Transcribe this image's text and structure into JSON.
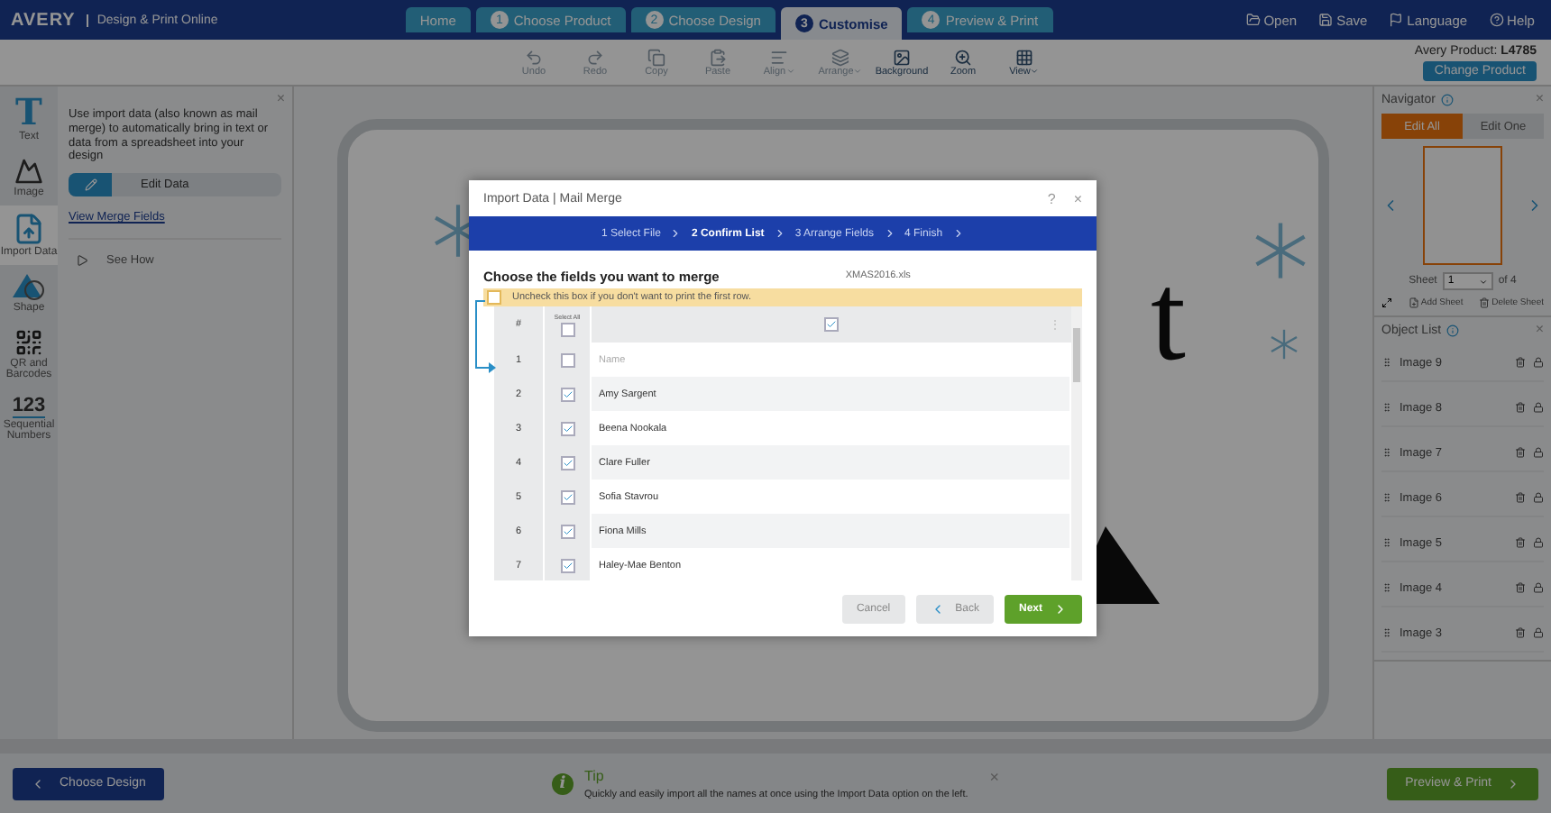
{
  "header": {
    "logo": "AVERY",
    "subtitle": "Design & Print Online",
    "tabs": [
      {
        "label": "Home",
        "selected": false
      },
      {
        "label": "Choose Product",
        "number": "1",
        "selected": false
      },
      {
        "label": "Choose Design",
        "number": "2",
        "selected": false
      },
      {
        "label": "Customise",
        "number": "3",
        "selected": true
      },
      {
        "label": "Preview & Print",
        "number": "4",
        "selected": false
      }
    ],
    "actions": [
      {
        "label": "Open",
        "kind": "open"
      },
      {
        "label": "Save",
        "kind": "save"
      },
      {
        "label": "Language",
        "kind": "flag"
      },
      {
        "label": "Help",
        "kind": "help"
      }
    ]
  },
  "toolbar": {
    "tools": [
      {
        "label": "Undo",
        "kind": "undo",
        "dropdown": false,
        "disabled": true
      },
      {
        "label": "Redo",
        "kind": "redo",
        "dropdown": false,
        "disabled": true
      },
      {
        "label": "Copy",
        "kind": "copy",
        "dropdown": false,
        "disabled": true
      },
      {
        "label": "Paste",
        "kind": "paste",
        "dropdown": false,
        "disabled": true
      },
      {
        "label": "Align",
        "kind": "align",
        "dropdown": true,
        "disabled": true
      },
      {
        "label": "Arrange",
        "kind": "arrange",
        "dropdown": true,
        "disabled": true
      },
      {
        "label": "Background",
        "kind": "background",
        "dropdown": false,
        "disabled": false
      },
      {
        "label": "Zoom",
        "kind": "zoom",
        "dropdown": false,
        "disabled": false
      },
      {
        "label": "View",
        "kind": "view",
        "dropdown": true,
        "disabled": false
      }
    ],
    "product": "Avery Product: **L4785**",
    "change_button": "Change Product"
  },
  "sidebar": {
    "items": [
      {
        "label": "Text",
        "kind": "text",
        "icon_text": "T",
        "selected": false
      },
      {
        "label": "Image",
        "kind": "image",
        "selected": false
      },
      {
        "label": "Import Data",
        "kind": "import",
        "selected": true
      },
      {
        "label": "Shape",
        "kind": "shape",
        "selected": false
      },
      {
        "label": "QR and Barcodes",
        "kind": "qr",
        "selected": false
      },
      {
        "label": "Sequential Numbers",
        "kind": "numbers",
        "icon_text": "123",
        "selected": false
      }
    ]
  },
  "panel": {
    "close": "×",
    "description": "Use import data (also known as mail merge) to automatically bring in text or data from a spreadsheet into your design",
    "edit_button": "Edit Data",
    "link": "View Merge Fields",
    "see_how": "See How"
  },
  "canvas": {
    "text": "t"
  },
  "navigator": {
    "title": "Navigator",
    "close": "×",
    "modes": [
      {
        "label": "Edit All",
        "selected": true
      },
      {
        "label": "Edit One",
        "selected": false
      }
    ],
    "sheet_label": "Sheet",
    "sheet_value": "1",
    "sheet_total": "of 4",
    "add_sheet": "Add Sheet",
    "delete_sheet": "Delete Sheet"
  },
  "object_list": {
    "title": "Object List",
    "close": "×",
    "items": [
      "Image 9",
      "Image 8",
      "Image 7",
      "Image 6",
      "Image 5",
      "Image 4",
      "Image 3"
    ]
  },
  "modal": {
    "title": "Import Data | Mail Merge",
    "help": "?",
    "close": "×",
    "steps": [
      {
        "label": "1 Select File",
        "selected": false
      },
      {
        "label": "2 Confirm List",
        "selected": true
      },
      {
        "label": "3 Arrange Fields",
        "selected": false
      },
      {
        "label": "4 Finish",
        "selected": false
      }
    ],
    "heading": "Choose the fields you want to merge",
    "filename": "XMAS2016.xls",
    "notice": {
      "text": "Uncheck this box if you don't want to print the first row.",
      "checked": false
    },
    "columns": {
      "number": "#",
      "select_all": "Select All",
      "select_all_checked": false,
      "field_checked": true,
      "menu": "⋮"
    },
    "rows": [
      {
        "number": "1",
        "checked": false,
        "name": "Name"
      },
      {
        "number": "2",
        "checked": true,
        "name": "Amy Sargent"
      },
      {
        "number": "3",
        "checked": true,
        "name": "Beena Nookala"
      },
      {
        "number": "4",
        "checked": true,
        "name": "Clare Fuller"
      },
      {
        "number": "5",
        "checked": true,
        "name": "Sofia Stavrou"
      },
      {
        "number": "6",
        "checked": true,
        "name": "Fiona Mills"
      },
      {
        "number": "7",
        "checked": true,
        "name": "Haley-Mae Benton"
      }
    ],
    "buttons": {
      "cancel": "Cancel",
      "back": "Back",
      "next": "Next"
    }
  },
  "footer": {
    "back_button": "Choose Design",
    "tip_title": "Tip",
    "tip_icon": "i",
    "tip_text": "Quickly and easily import all the names at once using the Import Data option on the left.",
    "tip_close": "×",
    "next_button": "Preview & Print"
  }
}
